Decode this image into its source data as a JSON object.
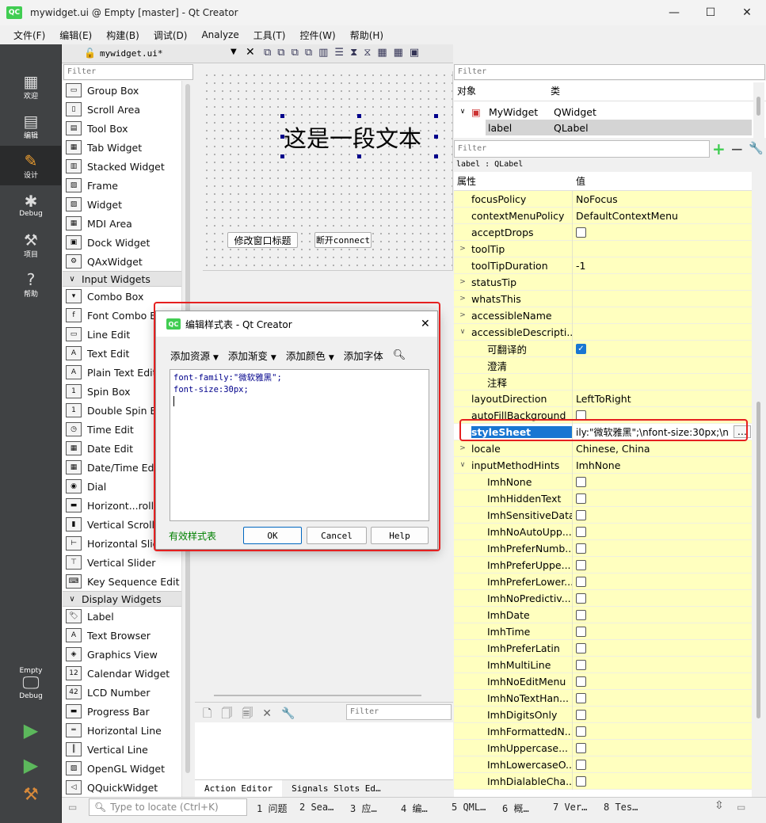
{
  "window": {
    "title": "mywidget.ui @ Empty [master] - Qt Creator",
    "logo": "QC",
    "min": "—",
    "max": "☐",
    "close": "✕"
  },
  "menu": [
    "文件(F)",
    "编辑(E)",
    "构建(B)",
    "调试(D)",
    "Analyze",
    "工具(T)",
    "控件(W)",
    "帮助(H)"
  ],
  "modes": [
    {
      "label": "欢迎",
      "icon": "welcome-icon"
    },
    {
      "label": "编辑",
      "icon": "edit-icon"
    },
    {
      "label": "设计",
      "icon": "design-icon"
    },
    {
      "label": "Debug",
      "icon": "debug-icon"
    },
    {
      "label": "项目",
      "icon": "projects-icon"
    },
    {
      "label": "帮助",
      "icon": "help-icon"
    }
  ],
  "kit": {
    "project": "Empty",
    "mode": "Debug"
  },
  "editor_tab": {
    "file": "mywidget.ui*"
  },
  "widgetbox": {
    "filter_placeholder": "Filter",
    "containers": [
      "Group Box",
      "Scroll Area",
      "Tool Box",
      "Tab Widget",
      "Stacked Widget",
      "Frame",
      "Widget",
      "MDI Area",
      "Dock Widget",
      "QAxWidget"
    ],
    "input_category": "Input Widgets",
    "inputs": [
      "Combo Box",
      "Font Combo Box",
      "Line Edit",
      "Text Edit",
      "Plain Text Edit",
      "Spin Box",
      "Double Spin Box",
      "Time Edit",
      "Date Edit",
      "Date/Time Edit",
      "Dial",
      "Horizont...roll Bar",
      "Vertical Scroll Bar",
      "Horizontal Slider",
      "Vertical Slider",
      "Key Sequence Edit"
    ],
    "display_category": "Display Widgets",
    "displays": [
      "Label",
      "Text Browser",
      "Graphics View",
      "Calendar Widget",
      "LCD Number",
      "Progress Bar",
      "Horizontal Line",
      "Vertical Line",
      "OpenGL Widget",
      "QQuickWidget"
    ]
  },
  "form": {
    "label_text": "这是一段文本",
    "button1": "修改窗口标题",
    "button2": "断开connect"
  },
  "action_editor": {
    "filter_placeholder": "Filter",
    "tab1": "Action Editor",
    "tab2": "Signals Slots Ed…"
  },
  "object_inspector": {
    "filter_placeholder": "Filter",
    "col_object": "对象",
    "col_class": "类",
    "rows": [
      {
        "object": "MyWidget",
        "class": "QWidget"
      },
      {
        "object": "label",
        "class": "QLabel"
      }
    ]
  },
  "property_editor": {
    "filter_placeholder": "Filter",
    "class_line": "label : QLabel",
    "col_property": "属性",
    "col_value": "值",
    "rows": [
      {
        "name": "focusPolicy",
        "value": "NoFocus",
        "indent": 0,
        "arrow": ""
      },
      {
        "name": "contextMenuPolicy",
        "value": "DefaultContextMenu",
        "indent": 0,
        "arrow": ""
      },
      {
        "name": "acceptDrops",
        "value": "",
        "check": "off",
        "indent": 0,
        "arrow": ""
      },
      {
        "name": "toolTip",
        "value": "",
        "indent": 0,
        "arrow": ">"
      },
      {
        "name": "toolTipDuration",
        "value": "-1",
        "indent": 0,
        "arrow": ""
      },
      {
        "name": "statusTip",
        "value": "",
        "indent": 0,
        "arrow": ">"
      },
      {
        "name": "whatsThis",
        "value": "",
        "indent": 0,
        "arrow": ">"
      },
      {
        "name": "accessibleName",
        "value": "",
        "indent": 0,
        "arrow": ">"
      },
      {
        "name": "accessibleDescripti...",
        "value": "",
        "indent": 0,
        "arrow": "v"
      },
      {
        "name": "可翻译的",
        "value": "",
        "check": "on",
        "indent": 1,
        "arrow": ""
      },
      {
        "name": "澄清",
        "value": "",
        "indent": 1,
        "arrow": ""
      },
      {
        "name": "注释",
        "value": "",
        "indent": 1,
        "arrow": ""
      },
      {
        "name": "layoutDirection",
        "value": "LeftToRight",
        "indent": 0,
        "arrow": ""
      },
      {
        "name": "autoFillBackground",
        "value": "",
        "check": "off",
        "indent": 0,
        "arrow": ""
      },
      {
        "name": "styleSheet",
        "value": "ily:\"微软雅黑\";\\nfont-size:30px;\\n",
        "indent": 0,
        "arrow": "",
        "selected": true
      },
      {
        "name": "locale",
        "value": "Chinese, China",
        "indent": 0,
        "arrow": ">"
      },
      {
        "name": "inputMethodHints",
        "value": "ImhNone",
        "indent": 0,
        "arrow": "v"
      },
      {
        "name": "ImhNone",
        "value": "",
        "check": "off",
        "indent": 1,
        "arrow": ""
      },
      {
        "name": "ImhHiddenText",
        "value": "",
        "check": "off",
        "indent": 1,
        "arrow": ""
      },
      {
        "name": "ImhSensitiveData",
        "value": "",
        "check": "off",
        "indent": 1,
        "arrow": ""
      },
      {
        "name": "ImhNoAutoUpp...",
        "value": "",
        "check": "off",
        "indent": 1,
        "arrow": ""
      },
      {
        "name": "ImhPreferNumb...",
        "value": "",
        "check": "off",
        "indent": 1,
        "arrow": ""
      },
      {
        "name": "ImhPreferUppe...",
        "value": "",
        "check": "off",
        "indent": 1,
        "arrow": ""
      },
      {
        "name": "ImhPreferLower...",
        "value": "",
        "check": "off",
        "indent": 1,
        "arrow": ""
      },
      {
        "name": "ImhNoPredictiv...",
        "value": "",
        "check": "off",
        "indent": 1,
        "arrow": ""
      },
      {
        "name": "ImhDate",
        "value": "",
        "check": "off",
        "indent": 1,
        "arrow": ""
      },
      {
        "name": "ImhTime",
        "value": "",
        "check": "off",
        "indent": 1,
        "arrow": ""
      },
      {
        "name": "ImhPreferLatin",
        "value": "",
        "check": "off",
        "indent": 1,
        "arrow": ""
      },
      {
        "name": "ImhMultiLine",
        "value": "",
        "check": "off",
        "indent": 1,
        "arrow": ""
      },
      {
        "name": "ImhNoEditMenu",
        "value": "",
        "check": "off",
        "indent": 1,
        "arrow": ""
      },
      {
        "name": "ImhNoTextHan...",
        "value": "",
        "check": "off",
        "indent": 1,
        "arrow": ""
      },
      {
        "name": "ImhDigitsOnly",
        "value": "",
        "check": "off",
        "indent": 1,
        "arrow": ""
      },
      {
        "name": "ImhFormattedN...",
        "value": "",
        "check": "off",
        "indent": 1,
        "arrow": ""
      },
      {
        "name": "ImhUppercase...",
        "value": "",
        "check": "off",
        "indent": 1,
        "arrow": ""
      },
      {
        "name": "ImhLowercaseO...",
        "value": "",
        "check": "off",
        "indent": 1,
        "arrow": ""
      },
      {
        "name": "ImhDialableCha...",
        "value": "",
        "check": "off",
        "indent": 1,
        "arrow": ""
      }
    ]
  },
  "dialog": {
    "title": "编辑样式表 - Qt Creator",
    "tools": [
      "添加资源",
      "添加渐变",
      "添加颜色",
      "添加字体"
    ],
    "lines": [
      "font-family:\"微软雅黑\";",
      "font-size:30px;"
    ],
    "valid": "有效样式表",
    "ok": "OK",
    "cancel": "Cancel",
    "help": "Help"
  },
  "statusbar": {
    "locate_placeholder": "Type to locate (Ctrl+K)",
    "items": [
      "1 问题",
      "2 Sea…",
      "3 应…",
      "4 编…",
      "5 QML…",
      "6 概…",
      "7 Ver…",
      "8 Tes…"
    ]
  },
  "colors": {
    "accent": "#41cd52",
    "property_bg": "#ffffbf",
    "selection": "#1976d2",
    "highlight_box": "#e52020"
  }
}
